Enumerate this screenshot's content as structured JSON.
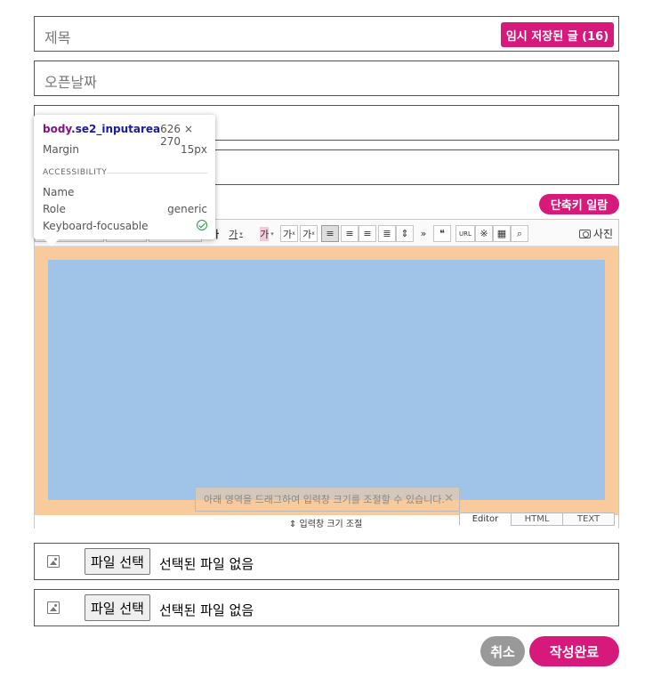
{
  "form": {
    "title_placeholder": "제목",
    "temp_saved_label": "임시 저장된 글 (16)",
    "open_date_placeholder": "오픈날짜",
    "field3_placeholder": "",
    "field4_placeholder": "",
    "shortcut_label": "단축키 일람"
  },
  "editor": {
    "toolbar": {
      "bold_label": "가",
      "font_color_label": "가",
      "background_color_label": "가",
      "superscript_label": "가",
      "subscript_label": "가",
      "more_label": "»",
      "quote_label": "❝",
      "url_label": "URL",
      "special_char_label": "※",
      "table_label": "▦",
      "find_label": "⌕",
      "photo_label": "사진",
      "icons": [
        "align-left-icon",
        "align-center-icon",
        "align-right-icon",
        "align-justify-icon",
        "line-height-icon",
        "camera-icon"
      ]
    },
    "drag_tip": "아래 영역을 드래그하여 입력창 크기를 조절할 수 있습니다.",
    "resize_label": "⇕ 입력창 크기 조절",
    "modes": [
      "Editor",
      "HTML",
      "TEXT"
    ],
    "active_mode": "Editor"
  },
  "files": [
    {
      "button_label": "파일 선택",
      "status": "선택된 파일 없음"
    },
    {
      "button_label": "파일 선택",
      "status": "선택된 파일 없음"
    }
  ],
  "actions": {
    "cancel_label": "취소",
    "submit_label": "작성완료"
  },
  "inspector": {
    "tag": "body",
    "class_name": ".se2_inputarea",
    "size": "626 × 270",
    "margin_label": "Margin",
    "margin_value": "15px",
    "section_label": "ACCESSIBILITY",
    "name_label": "Name",
    "name_value": "",
    "role_label": "Role",
    "role_value": "generic",
    "focus_label": "Keyboard-focusable"
  },
  "colors": {
    "accent": "#d6197a",
    "margin_overlay": "#f9cb9c",
    "content_overlay": "#9fc4e7",
    "cancel_gray": "#999999"
  }
}
